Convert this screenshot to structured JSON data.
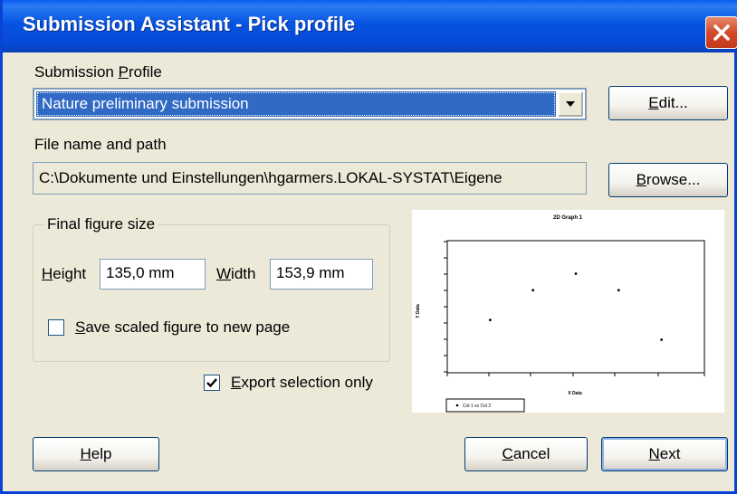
{
  "window": {
    "title": "Submission Assistant - Pick profile"
  },
  "profile": {
    "label_pre": "Submission ",
    "label_mnemonic": "P",
    "label_post": "rofile",
    "selected": "Nature preliminary submission",
    "edit_mnemonic": "E",
    "edit_rest": "dit..."
  },
  "file": {
    "label": "File name and path",
    "path": "C:\\Dokumente und Einstellungen\\hgarmers.LOKAL-SYSTAT\\Eigene",
    "browse_mnemonic": "B",
    "browse_rest": "rowse..."
  },
  "figure_size": {
    "group_title": "Final figure size",
    "height_mnemonic": "H",
    "height_rest": "eight",
    "height_value": "135,0 mm",
    "width_mnemonic": "W",
    "width_rest": "idth",
    "width_value": "153,9 mm",
    "save_scaled_mnemonic": "S",
    "save_scaled_rest": "ave scaled figure to new page",
    "save_scaled_checked": false
  },
  "export": {
    "mnemonic": "E",
    "rest": "xport selection only",
    "checked": true
  },
  "buttons": {
    "help_mnemonic": "H",
    "help_rest": "elp",
    "cancel_mnemonic": "C",
    "cancel_rest": "ancel",
    "next_mnemonic": "N",
    "next_rest": "ext"
  },
  "preview_chart": {
    "title": "2D Graph 1",
    "xlabel": "X Data",
    "ylabel": "Y Data",
    "legend": "Col 1 vs Col 2",
    "points": [
      [
        1,
        3.2
      ],
      [
        2,
        5.0
      ],
      [
        3,
        6.0
      ],
      [
        4,
        5.0
      ],
      [
        5,
        2.0
      ]
    ]
  }
}
